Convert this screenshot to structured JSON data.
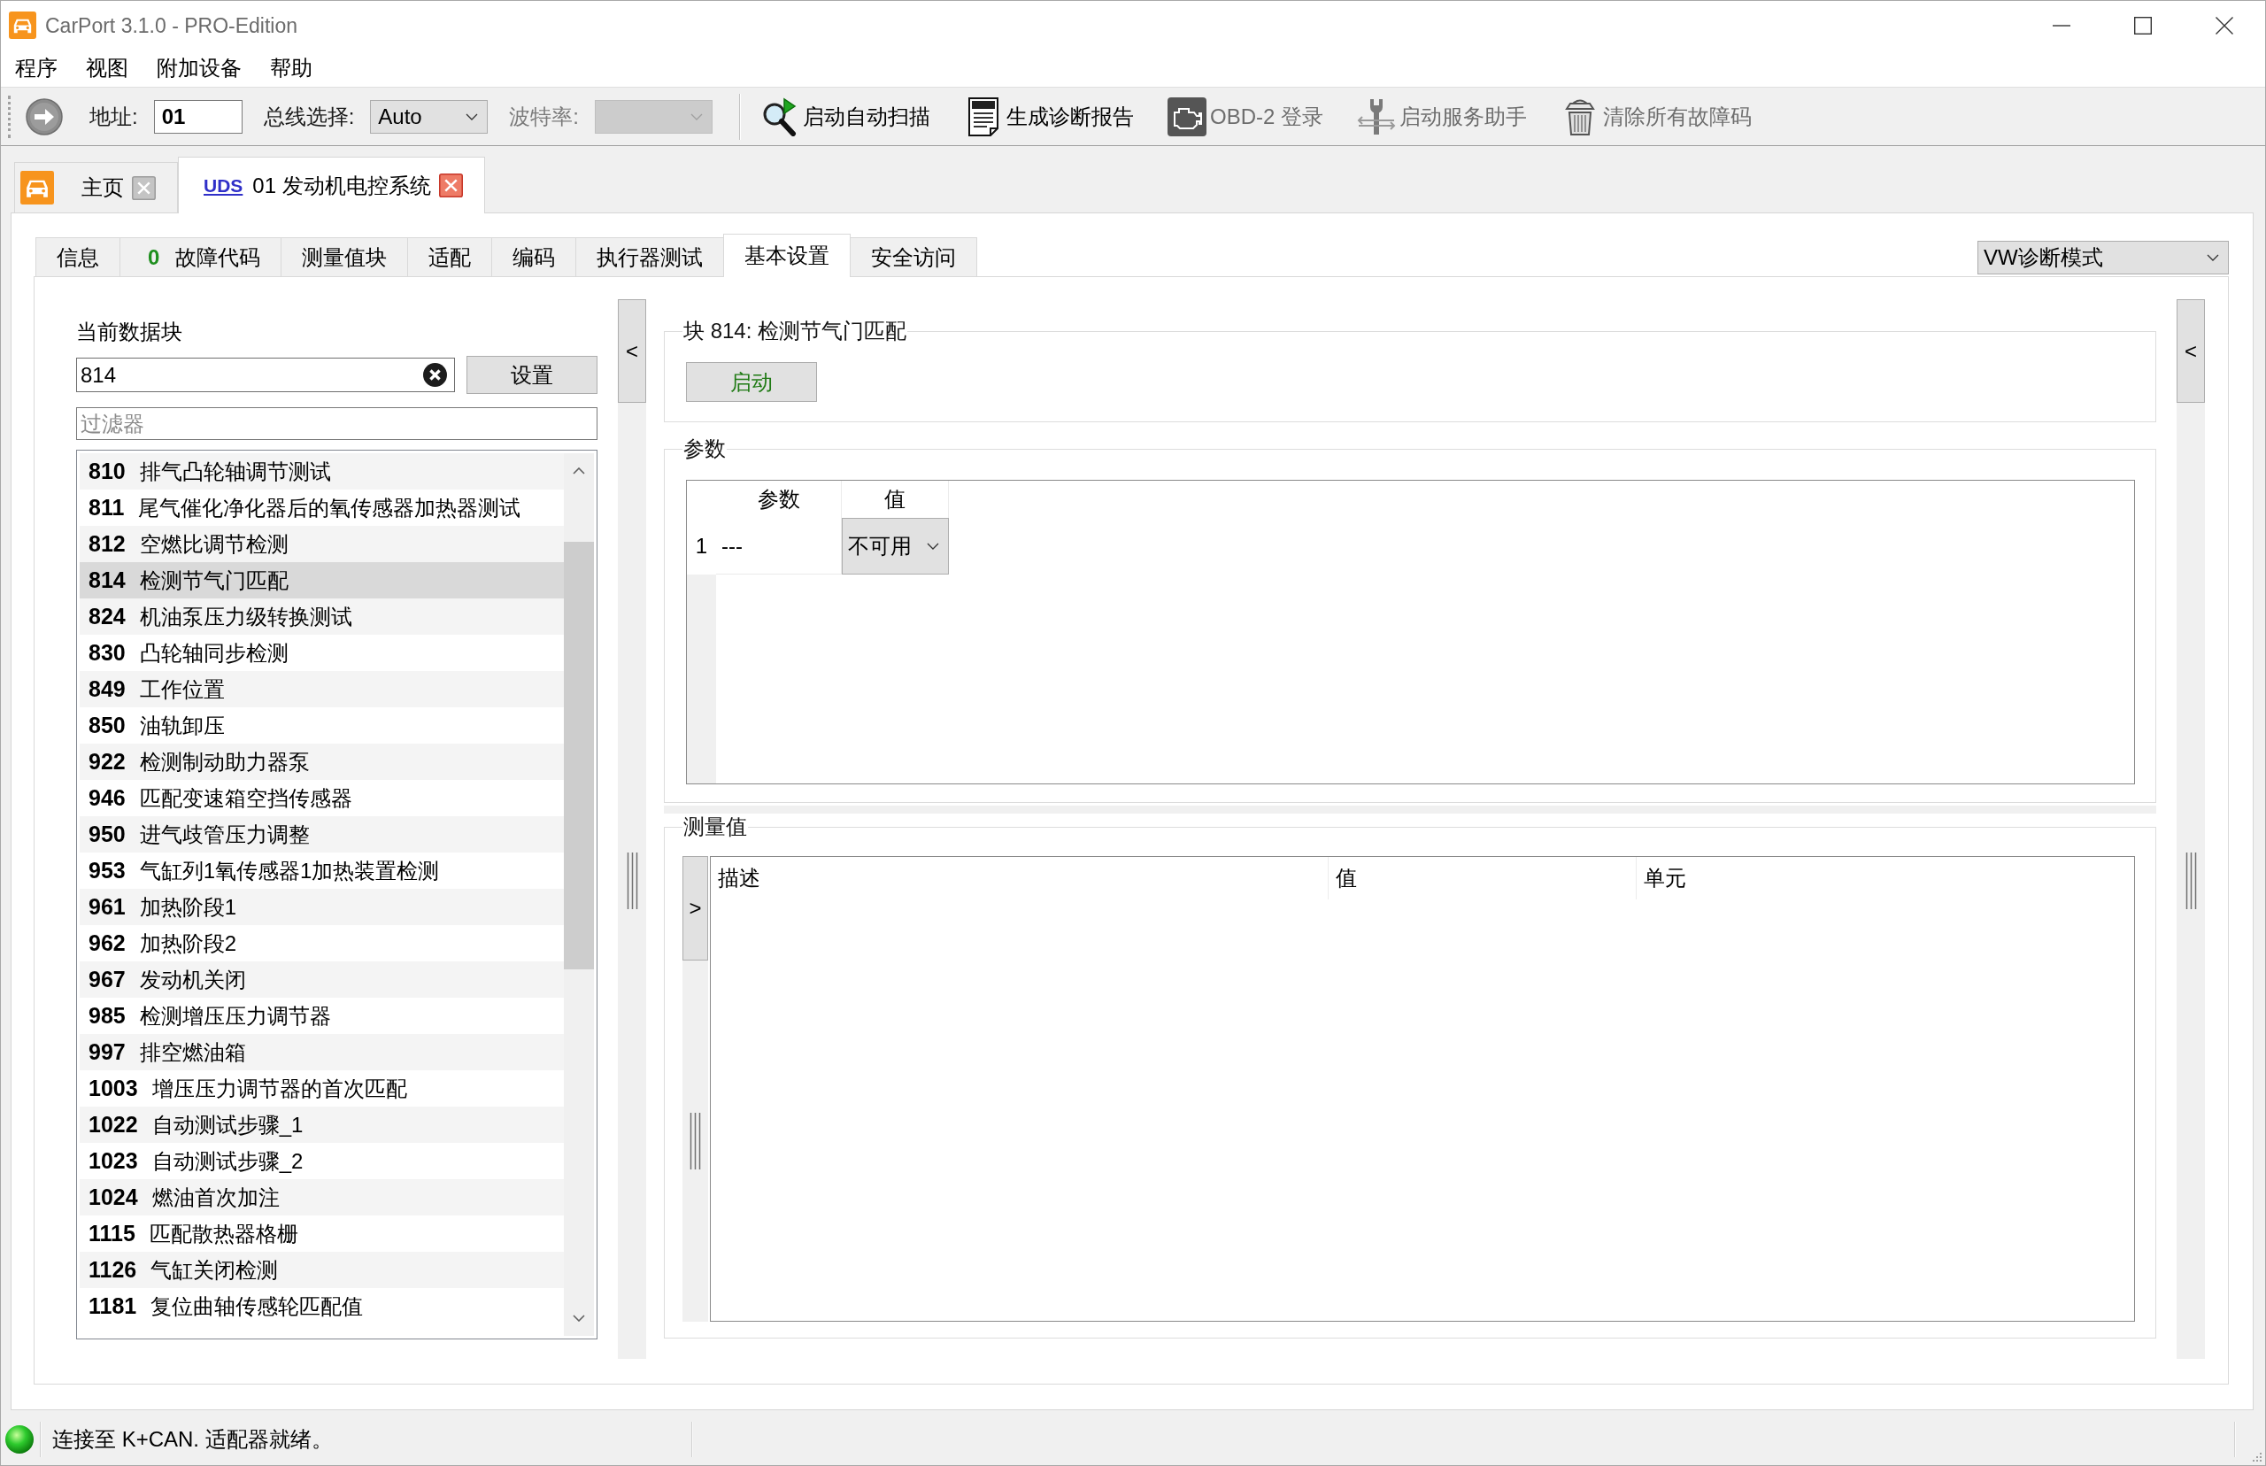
{
  "window": {
    "title": "CarPort 3.1.0 - PRO-Edition"
  },
  "menu": [
    "程序",
    "视图",
    "附加设备",
    "帮助"
  ],
  "toolbar": {
    "fields": [
      {
        "kind": "input",
        "label": "地址:",
        "value": "01",
        "disabled": false
      },
      {
        "kind": "select",
        "label": "总线选择:",
        "value": "Auto",
        "disabled": false
      },
      {
        "kind": "select",
        "label": "波特率:",
        "disabled": true
      }
    ],
    "actions": [
      {
        "kind": "scan",
        "label": "启动自动扫描",
        "disabled": false
      },
      {
        "kind": "report",
        "label": "生成诊断报告",
        "disabled": false
      },
      {
        "kind": "obd",
        "label": "OBD-2 登录",
        "disabled": true
      },
      {
        "kind": "service",
        "label": "启动服务助手",
        "disabled": true
      },
      {
        "kind": "clear",
        "label": "清除所有故障码",
        "disabled": true
      }
    ]
  },
  "doc_tabs": [
    {
      "kind": "home",
      "label": "主页",
      "selected": false
    },
    {
      "kind": "module",
      "protocol": "UDS",
      "label": "01 发动机电控系统",
      "selected": true
    }
  ],
  "tabs": [
    {
      "label": "信息",
      "selected": false
    },
    {
      "count": "0",
      "label": "故障代码",
      "selected": false
    },
    {
      "label": "测量值块",
      "selected": false
    },
    {
      "label": "适配",
      "selected": false
    },
    {
      "label": "编码",
      "selected": false
    },
    {
      "label": "执行器测试",
      "selected": false
    },
    {
      "label": "基本设置",
      "selected": true
    },
    {
      "label": "安全访问",
      "selected": false
    }
  ],
  "mode_select": {
    "value": "VW诊断模式"
  },
  "data_block": {
    "label": "当前数据块",
    "value": "814",
    "set_button": "设置",
    "filter": {
      "placeholder": "过滤器"
    },
    "items": [
      {
        "number": "810",
        "name": "排气凸轮轴调节测试",
        "selected": false
      },
      {
        "number": "811",
        "name": "尾气催化净化器后的氧传感器加热器测试",
        "selected": false
      },
      {
        "number": "812",
        "name": "空燃比调节检测",
        "selected": false
      },
      {
        "number": "814",
        "name": "检测节气门匹配",
        "selected": true
      },
      {
        "number": "824",
        "name": "机油泵压力级转换测试",
        "selected": false
      },
      {
        "number": "830",
        "name": "凸轮轴同步检测",
        "selected": false
      },
      {
        "number": "849",
        "name": "工作位置",
        "selected": false
      },
      {
        "number": "850",
        "name": "油轨卸压",
        "selected": false
      },
      {
        "number": "922",
        "name": "检测制动助力器泵",
        "selected": false
      },
      {
        "number": "946",
        "name": "匹配变速箱空挡传感器",
        "selected": false
      },
      {
        "number": "950",
        "name": "进气歧管压力调整",
        "selected": false
      },
      {
        "number": "953",
        "name": "气缸列1氧传感器1加热装置检测",
        "selected": false
      },
      {
        "number": "961",
        "name": "加热阶段1",
        "selected": false
      },
      {
        "number": "962",
        "name": "加热阶段2",
        "selected": false
      },
      {
        "number": "967",
        "name": "发动机关闭",
        "selected": false
      },
      {
        "number": "985",
        "name": "检测增压压力调节器",
        "selected": false
      },
      {
        "number": "997",
        "name": "排空燃油箱",
        "selected": false
      },
      {
        "number": "1003",
        "name": "增压压力调节器的首次匹配",
        "selected": false
      },
      {
        "number": "1022",
        "name": "自动测试步骤_1",
        "selected": false
      },
      {
        "number": "1023",
        "name": "自动测试步骤_2",
        "selected": false
      },
      {
        "number": "1024",
        "name": "燃油首次加注",
        "selected": false
      },
      {
        "number": "1115",
        "name": "匹配散热器格栅",
        "selected": false
      },
      {
        "number": "1126",
        "name": "气缸关闭检测",
        "selected": false
      },
      {
        "number": "1181",
        "name": "复位曲轴传感轮匹配值",
        "selected": false
      }
    ]
  },
  "panel_toggles": {
    "left": "<",
    "right": "<"
  },
  "block_group": {
    "title": "块 814: 检测节气门匹配",
    "button": "启动"
  },
  "parameters": {
    "title": "参数",
    "columns": [
      "参数",
      "值"
    ],
    "rows": [
      {
        "index": "1",
        "name": "---",
        "value": "不可用"
      }
    ]
  },
  "measurements": {
    "title": "测量值",
    "toggle": ">",
    "columns": [
      "描述",
      "值",
      "单元"
    ]
  },
  "status_bar": {
    "connected": true,
    "text": "连接至 K+CAN. 适配器就绪。"
  }
}
